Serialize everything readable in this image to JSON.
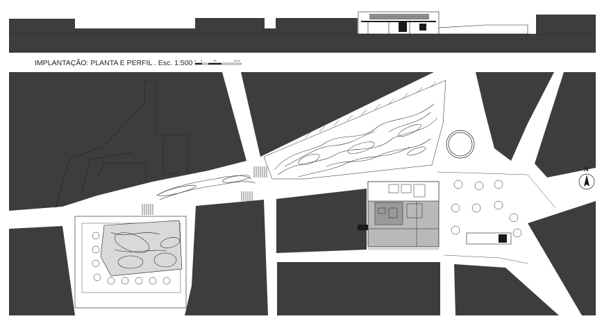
{
  "title": "IMPLANTAÇÃO: PLANTA E PERFIL . Esc. 1:500",
  "scale_bar": {
    "ticks": [
      "0",
      "5",
      "15",
      "25 m"
    ]
  },
  "north_arrow": {
    "label": "N"
  },
  "colors": {
    "block": "#3d3d3d",
    "background": "#ffffff",
    "building": "#b9b9b9",
    "building_dark": "#9a9a9a",
    "line": "#1a1a1a"
  }
}
